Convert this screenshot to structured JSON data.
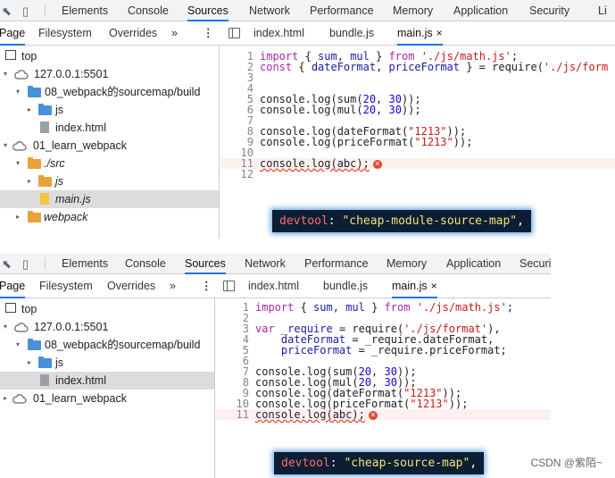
{
  "tabs": [
    "Elements",
    "Console",
    "Sources",
    "Network",
    "Performance",
    "Memory",
    "Application",
    "Security",
    "Li"
  ],
  "tabs_bottom": [
    "Elements",
    "Console",
    "Sources",
    "Network",
    "Performance",
    "Memory",
    "Application",
    "Securi"
  ],
  "subtabs": {
    "page": "Page",
    "filesystem": "Filesystem",
    "overrides": "Overrides",
    "more": "»",
    "kebab": "⋮"
  },
  "file_tabs_top": {
    "a": "index.html",
    "b": "bundle.js",
    "c": "main.js",
    "close": "×"
  },
  "file_tabs_bottom": {
    "a": "index.html",
    "b": "bundle.js",
    "c": "main.js",
    "close": "×"
  },
  "tree_top": {
    "top": "top",
    "origin": "127.0.0.1:5501",
    "build": "08_webpack的sourcemap/build",
    "js": "js",
    "index": "index.html",
    "learn": "01_learn_webpack",
    "src": "./src",
    "js2": "js",
    "main": "main.js",
    "webpack": "webpack"
  },
  "tree_bottom": {
    "top": "top",
    "origin": "127.0.0.1:5501",
    "build": "08_webpack的sourcemap/build",
    "js": "js",
    "index": "index.html",
    "learn": "01_learn_webpack"
  },
  "code_top": [
    {
      "n": "1",
      "segs": [
        [
          "import",
          "k"
        ],
        [
          " { ",
          ""
        ],
        [
          "sum",
          "v"
        ],
        [
          ", ",
          ""
        ],
        [
          "mul",
          "v"
        ],
        [
          " } ",
          ""
        ],
        [
          "from",
          "k"
        ],
        [
          " ",
          ""
        ],
        [
          "'./js/math.js'",
          "s"
        ],
        [
          ";",
          ""
        ]
      ]
    },
    {
      "n": "2",
      "segs": [
        [
          "const",
          "k"
        ],
        [
          " { ",
          ""
        ],
        [
          "dateFormat",
          "v"
        ],
        [
          ", ",
          ""
        ],
        [
          "priceFormat",
          "v"
        ],
        [
          " } = require(",
          ""
        ],
        [
          "'./js/form",
          "s"
        ]
      ]
    },
    {
      "n": "3",
      "segs": []
    },
    {
      "n": "4",
      "segs": []
    },
    {
      "n": "5",
      "segs": [
        [
          "console.log(sum(",
          ""
        ],
        [
          "20",
          "n"
        ],
        [
          ", ",
          ""
        ],
        [
          "30",
          "n"
        ],
        [
          "));",
          ""
        ]
      ]
    },
    {
      "n": "6",
      "segs": [
        [
          "console.log(mul(",
          ""
        ],
        [
          "20",
          "n"
        ],
        [
          ", ",
          ""
        ],
        [
          "30",
          "n"
        ],
        [
          "));",
          ""
        ]
      ]
    },
    {
      "n": "7",
      "segs": []
    },
    {
      "n": "8",
      "segs": [
        [
          "console.log(dateFormat(",
          ""
        ],
        [
          "\"1213\"",
          "s"
        ],
        [
          "));",
          ""
        ]
      ]
    },
    {
      "n": "9",
      "segs": [
        [
          "console.log(priceFormat(",
          ""
        ],
        [
          "\"1213\"",
          "s"
        ],
        [
          "));",
          ""
        ]
      ]
    },
    {
      "n": "10",
      "segs": []
    },
    {
      "n": "11",
      "segs": [
        [
          "console.log(abc);",
          "w"
        ]
      ],
      "err": true
    },
    {
      "n": "12",
      "segs": []
    }
  ],
  "code_bottom": [
    {
      "n": "1",
      "segs": [
        [
          "import",
          "k"
        ],
        [
          " { ",
          ""
        ],
        [
          "sum",
          "v"
        ],
        [
          ", ",
          ""
        ],
        [
          "mul",
          "v"
        ],
        [
          " } ",
          ""
        ],
        [
          "from",
          "k"
        ],
        [
          " ",
          ""
        ],
        [
          "'./js/math.js'",
          "s"
        ],
        [
          ";",
          ""
        ]
      ]
    },
    {
      "n": "2",
      "segs": []
    },
    {
      "n": "3",
      "segs": [
        [
          "var",
          "k"
        ],
        [
          " ",
          ""
        ],
        [
          "_require",
          "v"
        ],
        [
          " = require(",
          ""
        ],
        [
          "'./js/format'",
          "s"
        ],
        [
          "),",
          ""
        ]
      ]
    },
    {
      "n": "4",
      "segs": [
        [
          "    ",
          ""
        ],
        [
          "dateFormat",
          "v"
        ],
        [
          " = _require.dateFormat,",
          ""
        ]
      ]
    },
    {
      "n": "5",
      "segs": [
        [
          "    ",
          ""
        ],
        [
          "priceFormat",
          "v"
        ],
        [
          " = _require.priceFormat;",
          ""
        ]
      ]
    },
    {
      "n": "6",
      "segs": []
    },
    {
      "n": "7",
      "segs": [
        [
          "console.log(sum(",
          ""
        ],
        [
          "20",
          "n"
        ],
        [
          ", ",
          ""
        ],
        [
          "30",
          "n"
        ],
        [
          "));",
          ""
        ]
      ]
    },
    {
      "n": "8",
      "segs": [
        [
          "console.log(mul(",
          ""
        ],
        [
          "20",
          "n"
        ],
        [
          ", ",
          ""
        ],
        [
          "30",
          "n"
        ],
        [
          "));",
          ""
        ]
      ]
    },
    {
      "n": "9",
      "segs": [
        [
          "console.log(dateFormat(",
          ""
        ],
        [
          "\"1213\"",
          "s"
        ],
        [
          "));",
          ""
        ]
      ]
    },
    {
      "n": "10",
      "segs": [
        [
          "console.log(priceFormat(",
          ""
        ],
        [
          "\"1213\"",
          "s"
        ],
        [
          "));",
          ""
        ]
      ]
    },
    {
      "n": "11",
      "segs": [
        [
          "console.log(abc);",
          "w"
        ]
      ],
      "err": true
    }
  ],
  "error_glyph": "✕",
  "badge_top": {
    "key": "devtool",
    "colon": ": ",
    "val": "\"cheap-module-source-map\"",
    "tail": ","
  },
  "badge_bottom": {
    "key": "devtool",
    "colon": ": ",
    "val": "\"cheap-source-map\"",
    "tail": ","
  },
  "watermark": "CSDN @紫陌~",
  "icons": {
    "inspect": "⬉",
    "device": "▯",
    "expand": "▾",
    "collapse": "▸"
  }
}
